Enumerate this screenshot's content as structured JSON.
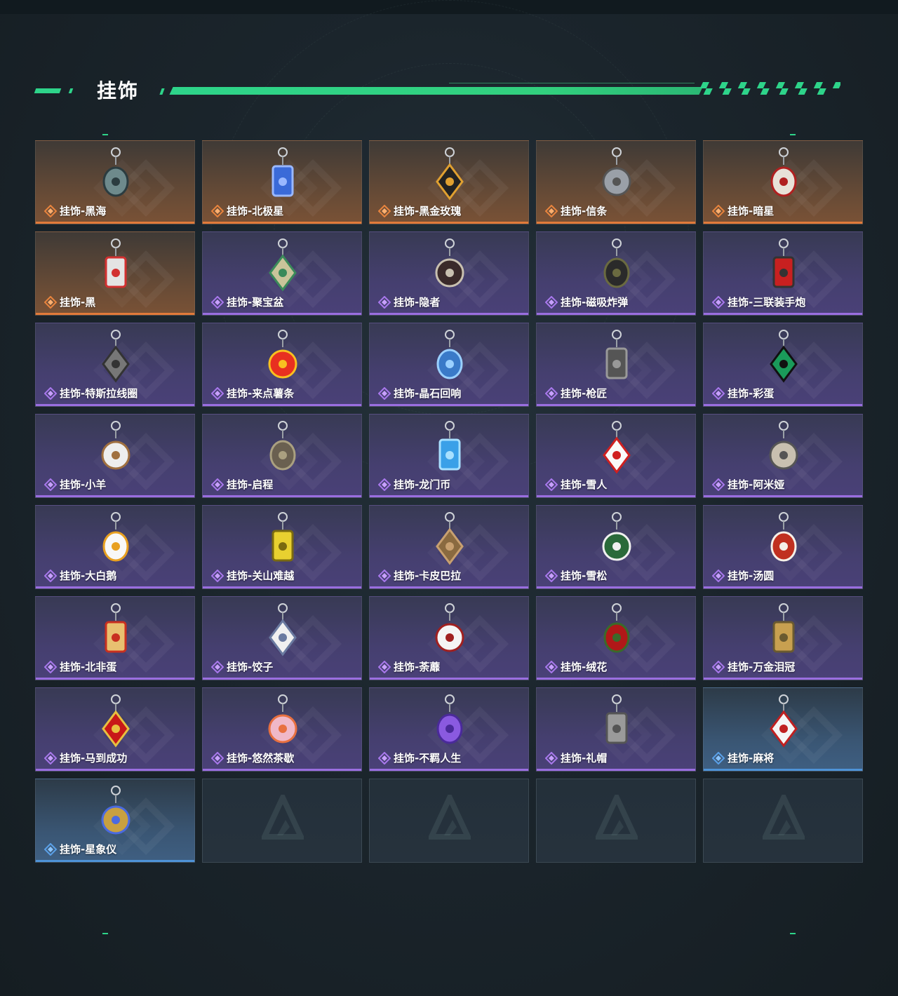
{
  "header": {
    "title": "挂饰"
  },
  "colors": {
    "accent": "#2ed48a",
    "orange": "#e27a3a",
    "purple": "#9a6ee0",
    "blue": "#4e93d8"
  },
  "items": [
    {
      "label": "挂饰-黑海",
      "rarity": "orange",
      "icon": "anchor-pendant-icon"
    },
    {
      "label": "挂饰-北极星",
      "rarity": "orange",
      "icon": "star-pendant-icon"
    },
    {
      "label": "挂饰-黑金玫瑰",
      "rarity": "orange",
      "icon": "rose-pendant-icon"
    },
    {
      "label": "挂饰-信条",
      "rarity": "orange",
      "icon": "creed-pendant-icon"
    },
    {
      "label": "挂饰-暗星",
      "rarity": "orange",
      "icon": "bird-pendant-icon"
    },
    {
      "label": "挂饰-黑",
      "rarity": "orange",
      "icon": "tag-pendant-icon"
    },
    {
      "label": "挂饰-聚宝盆",
      "rarity": "purple",
      "icon": "treasure-bowl-icon"
    },
    {
      "label": "挂饰-隐者",
      "rarity": "purple",
      "icon": "card-pendant-icon"
    },
    {
      "label": "挂饰-磁吸炸弹",
      "rarity": "purple",
      "icon": "bomb-pendant-icon"
    },
    {
      "label": "挂饰-三联装手炮",
      "rarity": "purple",
      "icon": "cannon-pendant-icon"
    },
    {
      "label": "挂饰-特斯拉线圈",
      "rarity": "purple",
      "icon": "tesla-coil-icon"
    },
    {
      "label": "挂饰-来点薯条",
      "rarity": "purple",
      "icon": "fries-pendant-icon"
    },
    {
      "label": "挂饰-晶石回响",
      "rarity": "purple",
      "icon": "crystal-pendant-icon"
    },
    {
      "label": "挂饰-枪匠",
      "rarity": "purple",
      "icon": "gunsmith-pendant-icon"
    },
    {
      "label": "挂饰-彩蛋",
      "rarity": "purple",
      "icon": "egg-pendant-icon"
    },
    {
      "label": "挂饰-小羊",
      "rarity": "purple",
      "icon": "sheep-pendant-icon"
    },
    {
      "label": "挂饰-启程",
      "rarity": "purple",
      "icon": "medal-pendant-icon"
    },
    {
      "label": "挂饰-龙门币",
      "rarity": "purple",
      "icon": "coin-pendant-icon"
    },
    {
      "label": "挂饰-雪人",
      "rarity": "purple",
      "icon": "snowman-pendant-icon"
    },
    {
      "label": "挂饰-阿米娅",
      "rarity": "purple",
      "icon": "amiya-pendant-icon"
    },
    {
      "label": "挂饰-大白鹅",
      "rarity": "purple",
      "icon": "goose-pendant-icon"
    },
    {
      "label": "挂饰-关山难越",
      "rarity": "purple",
      "icon": "gold-bar-pendant-icon"
    },
    {
      "label": "挂饰-卡皮巴拉",
      "rarity": "purple",
      "icon": "capybara-pendant-icon"
    },
    {
      "label": "挂饰-雪松",
      "rarity": "purple",
      "icon": "pine-tree-pendant-icon"
    },
    {
      "label": "挂饰-汤圆",
      "rarity": "purple",
      "icon": "dumpling-bowl-icon"
    },
    {
      "label": "挂饰-北非蛋",
      "rarity": "purple",
      "icon": "shakshuka-pendant-icon"
    },
    {
      "label": "挂饰-饺子",
      "rarity": "purple",
      "icon": "dumplings-plate-icon"
    },
    {
      "label": "挂饰-荼蘼",
      "rarity": "purple",
      "icon": "flower-doll-pendant-icon"
    },
    {
      "label": "挂饰-绒花",
      "rarity": "purple",
      "icon": "red-flower-pendant-icon"
    },
    {
      "label": "挂饰-万金泪冠",
      "rarity": "purple",
      "icon": "crown-pendant-icon"
    },
    {
      "label": "挂饰-马到成功",
      "rarity": "purple",
      "icon": "horse-pendant-icon"
    },
    {
      "label": "挂饰-悠然茶歇",
      "rarity": "purple",
      "icon": "cupcake-pendant-icon"
    },
    {
      "label": "挂饰-不羁人生",
      "rarity": "purple",
      "icon": "sneaker-pendant-icon"
    },
    {
      "label": "挂饰-礼帽",
      "rarity": "purple",
      "icon": "hat-pendant-icon"
    },
    {
      "label": "挂饰-麻将",
      "rarity": "blue",
      "icon": "mahjong-pendant-icon"
    },
    {
      "label": "挂饰-星象仪",
      "rarity": "blue",
      "icon": "astrolabe-pendant-icon"
    },
    {
      "label": "",
      "rarity": "empty",
      "icon": "empty-slot-logo-icon"
    },
    {
      "label": "",
      "rarity": "empty",
      "icon": "empty-slot-logo-icon"
    },
    {
      "label": "",
      "rarity": "empty",
      "icon": "empty-slot-logo-icon"
    },
    {
      "label": "",
      "rarity": "empty",
      "icon": "empty-slot-logo-icon"
    }
  ]
}
